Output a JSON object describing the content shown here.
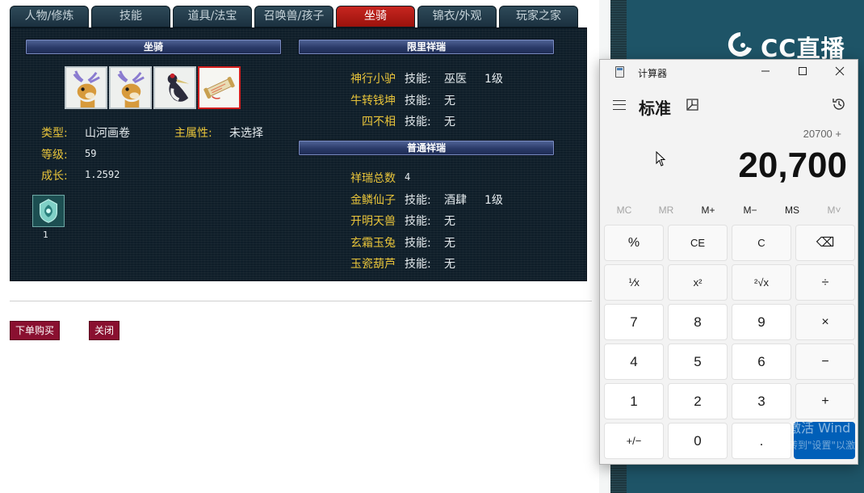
{
  "game": {
    "tabs": [
      {
        "label": "人物/修炼"
      },
      {
        "label": "技能"
      },
      {
        "label": "道具/法宝"
      },
      {
        "label": "召唤兽/孩子"
      },
      {
        "label": "坐骑"
      },
      {
        "label": "锦衣/外观"
      },
      {
        "label": "玩家之家"
      }
    ],
    "active_tab": "坐骑",
    "mount_section": {
      "heading": "坐骑",
      "type_label": "类型:",
      "type_value": "山河画卷",
      "main_attr_label": "主属性:",
      "main_attr_value": "未选择",
      "level_label": "等级:",
      "level_value": "59",
      "growth_label": "成长:",
      "growth_value": "1.2592",
      "badge_count": "1"
    },
    "limited_section": {
      "heading": "限里祥瑞",
      "items": [
        {
          "name": "神行小驴",
          "skill_label": "技能:",
          "skill": "巫医",
          "level": "1级"
        },
        {
          "name": "牛转钱坤",
          "skill_label": "技能:",
          "skill": "无",
          "level": ""
        },
        {
          "name": "四不相",
          "skill_label": "技能:",
          "skill": "无",
          "level": ""
        }
      ]
    },
    "normal_section": {
      "heading": "普通祥瑞",
      "total_label": "祥瑞总数",
      "total_value": "4",
      "items": [
        {
          "name": "金鳞仙子",
          "skill_label": "技能:",
          "skill": "酒肆",
          "level": "1级"
        },
        {
          "name": "开明天兽",
          "skill_label": "技能:",
          "skill": "无",
          "level": ""
        },
        {
          "name": "玄霜玉兔",
          "skill_label": "技能:",
          "skill": "无",
          "level": ""
        },
        {
          "name": "玉瓷葫芦",
          "skill_label": "技能:",
          "skill": "无",
          "level": ""
        }
      ]
    },
    "buttons": {
      "buy": "下单购买",
      "close": "关闭"
    }
  },
  "stream_logo": {
    "text": "CC直播"
  },
  "calculator": {
    "title": "计算器",
    "mode": "标准",
    "expression": "20700 +",
    "display": "20,700",
    "memory": [
      "MC",
      "MR",
      "M+",
      "M−",
      "MS",
      "M˅"
    ],
    "keys": [
      [
        "%",
        "CE",
        "C",
        "⌫"
      ],
      [
        "⅟x",
        "x²",
        "²√x",
        "÷"
      ],
      [
        "7",
        "8",
        "9",
        "×"
      ],
      [
        "4",
        "5",
        "6",
        "−"
      ],
      [
        "1",
        "2",
        "3",
        "+"
      ],
      [
        "+/−",
        "0",
        ".",
        ""
      ]
    ]
  },
  "watermark": {
    "line1": "激活 Wind",
    "line2": "转到\"设置\"以激"
  },
  "colors": {
    "accent_red": "#c72620",
    "label_gold": "#e8c43a",
    "calc_accent": "#005fb8"
  }
}
